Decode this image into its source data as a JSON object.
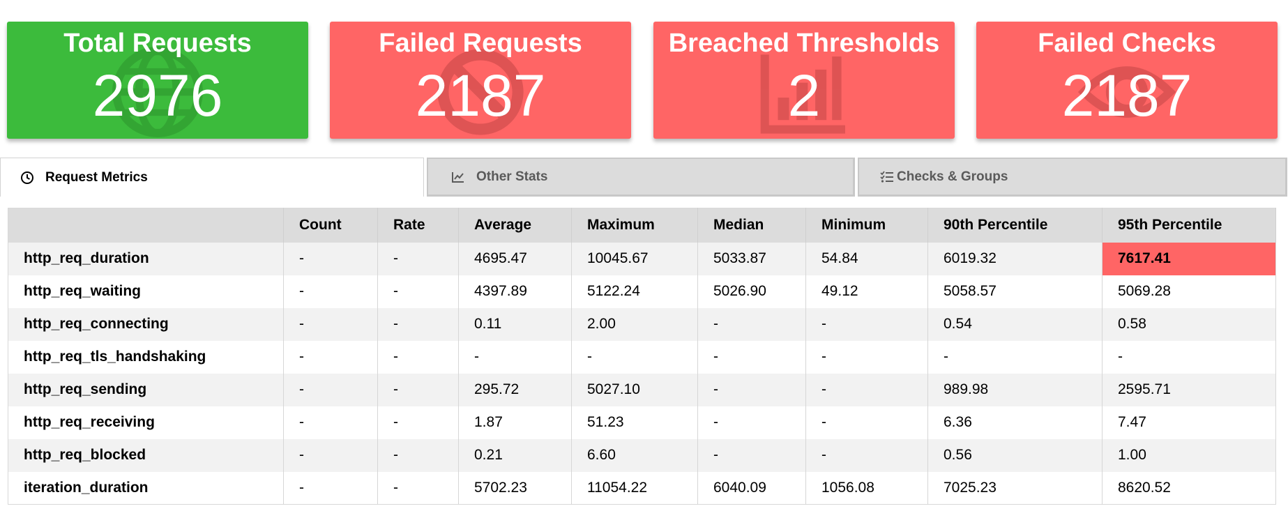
{
  "colors": {
    "success": "#3cbb3c",
    "failure": "#ff6565",
    "header_bg": "#dcdcdc"
  },
  "cards": [
    {
      "title": "Total Requests",
      "value": "2976",
      "status": "success",
      "icon": "globe-icon"
    },
    {
      "title": "Failed Requests",
      "value": "2187",
      "status": "failure",
      "icon": "ban-icon"
    },
    {
      "title": "Breached Thresholds",
      "value": "2",
      "status": "failure",
      "icon": "chart-icon"
    },
    {
      "title": "Failed Checks",
      "value": "2187",
      "status": "failure",
      "icon": "eye-icon"
    }
  ],
  "tabs": [
    {
      "label": "Request Metrics",
      "icon": "clock-icon",
      "active": true
    },
    {
      "label": "Other Stats",
      "icon": "line-chart-icon",
      "active": false
    },
    {
      "label": "Checks & Groups",
      "icon": "checklist-icon",
      "active": false
    }
  ],
  "table": {
    "columns": [
      "",
      "Count",
      "Rate",
      "Average",
      "Maximum",
      "Median",
      "Minimum",
      "90th Percentile",
      "95th Percentile"
    ],
    "rows": [
      {
        "name": "http_req_duration",
        "cells": [
          "-",
          "-",
          "4695.47",
          "10045.67",
          "5033.87",
          "54.84",
          "6019.32",
          "7617.41"
        ],
        "breached": [
          7
        ]
      },
      {
        "name": "http_req_waiting",
        "cells": [
          "-",
          "-",
          "4397.89",
          "5122.24",
          "5026.90",
          "49.12",
          "5058.57",
          "5069.28"
        ],
        "breached": []
      },
      {
        "name": "http_req_connecting",
        "cells": [
          "-",
          "-",
          "0.11",
          "2.00",
          "-",
          "-",
          "0.54",
          "0.58"
        ],
        "breached": []
      },
      {
        "name": "http_req_tls_handshaking",
        "cells": [
          "-",
          "-",
          "-",
          "-",
          "-",
          "-",
          "-",
          "-"
        ],
        "breached": []
      },
      {
        "name": "http_req_sending",
        "cells": [
          "-",
          "-",
          "295.72",
          "5027.10",
          "-",
          "-",
          "989.98",
          "2595.71"
        ],
        "breached": []
      },
      {
        "name": "http_req_receiving",
        "cells": [
          "-",
          "-",
          "1.87",
          "51.23",
          "-",
          "-",
          "6.36",
          "7.47"
        ],
        "breached": []
      },
      {
        "name": "http_req_blocked",
        "cells": [
          "-",
          "-",
          "0.21",
          "6.60",
          "-",
          "-",
          "0.56",
          "1.00"
        ],
        "breached": []
      },
      {
        "name": "iteration_duration",
        "cells": [
          "-",
          "-",
          "5702.23",
          "11054.22",
          "6040.09",
          "1056.08",
          "7025.23",
          "8620.52"
        ],
        "breached": []
      }
    ]
  }
}
